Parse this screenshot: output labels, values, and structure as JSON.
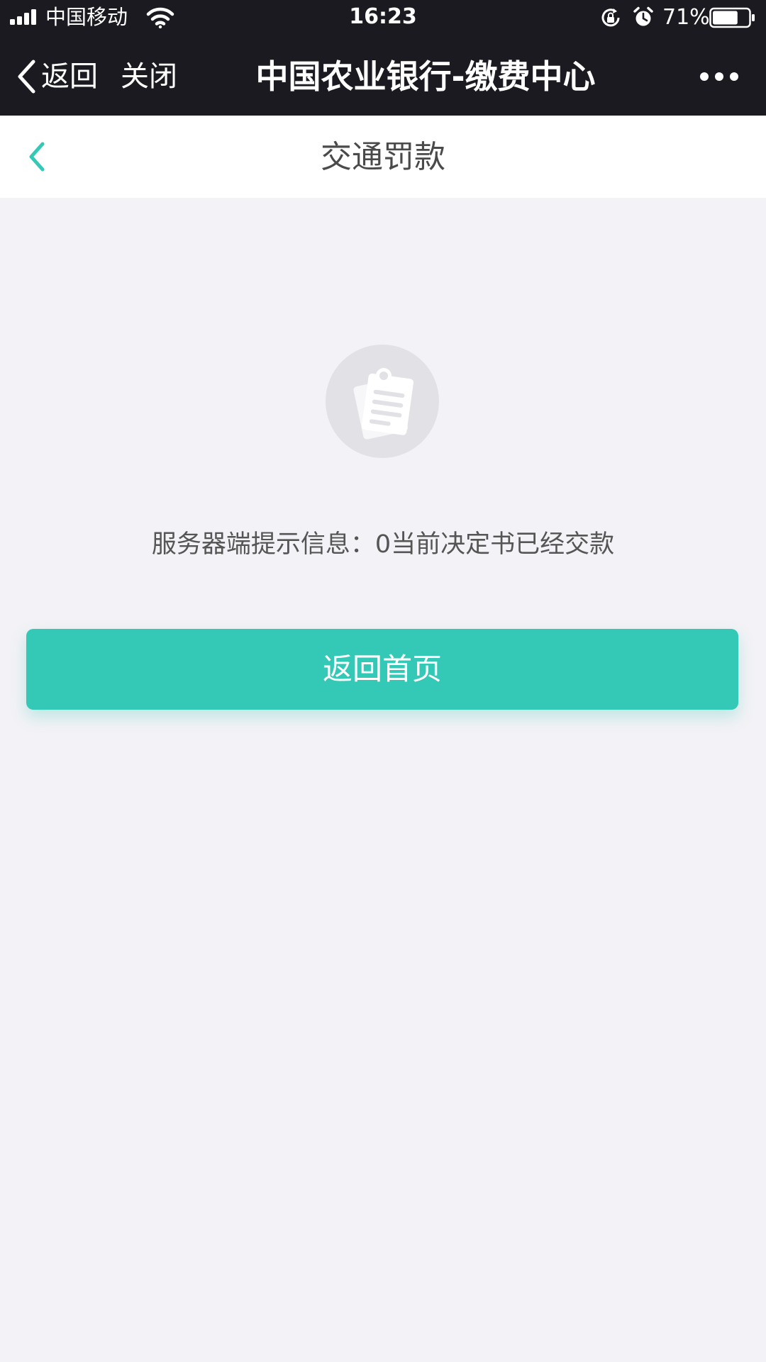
{
  "status_bar": {
    "carrier": "中国移动",
    "time": "16:23",
    "battery_percent": "71%",
    "battery_level": 0.71
  },
  "nav_bar": {
    "back_label": "返回",
    "close_label": "关闭",
    "title": "中国农业银行-缴费中心",
    "more_icon": "more-dots-icon"
  },
  "page_header": {
    "title": "交通罚款",
    "back_icon": "chevron-left-icon"
  },
  "content": {
    "illustration_icon": "empty-document-icon",
    "message": "服务器端提示信息：0当前决定书已经交款",
    "home_button_label": "返回首页"
  },
  "colors": {
    "accent": "#34c9b7",
    "nav_background": "#1b1a20",
    "page_background": "#f3f2f6"
  }
}
